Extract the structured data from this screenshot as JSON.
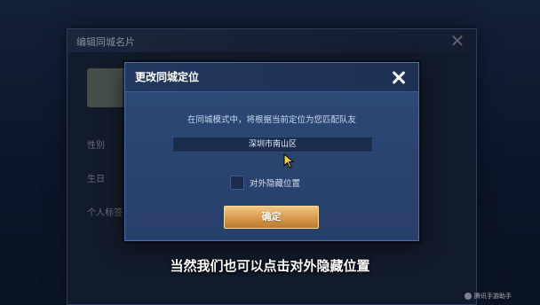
{
  "background_dialog": {
    "title": "编辑同城名片",
    "rows": [
      "性别",
      "生日",
      "个人标签"
    ]
  },
  "dialog": {
    "title": "更改同城定位",
    "description": "在同城模式中，将根据当前定位为您匹配队友",
    "location": "深圳市南山区",
    "hide_location_label": "对外隐藏位置",
    "hide_location_checked": false,
    "confirm_label": "确定"
  },
  "subtitle": "当然我们也可以点击对外隐藏位置",
  "watermark": "腾讯手游助手",
  "colors": {
    "dialog_bg": "#2d4a78",
    "header_bg": "#22385e",
    "confirm_button": "#d69a4a"
  },
  "icons": {
    "close": "close-icon",
    "cursor": "mouse-cursor-icon"
  }
}
